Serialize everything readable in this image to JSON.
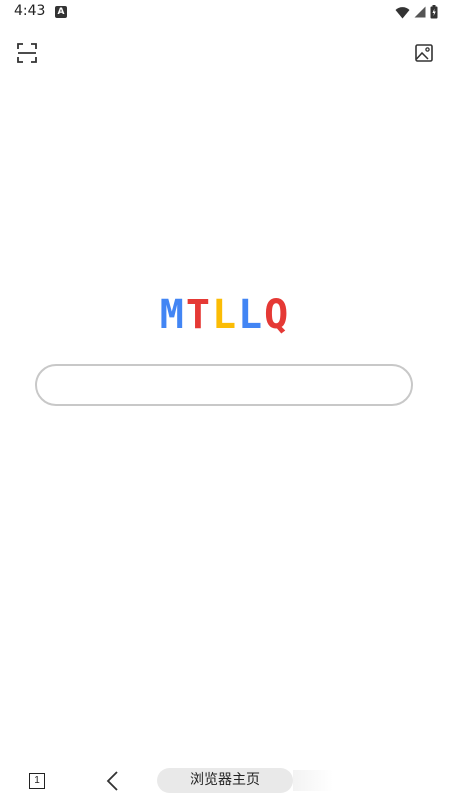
{
  "status_bar": {
    "time": "4:43",
    "notification_icon": "a-icon",
    "icons": [
      "wifi-icon",
      "signal-icon",
      "battery-icon"
    ]
  },
  "toolbar": {
    "left_icon": "scan-icon",
    "right_icon": "image-icon"
  },
  "logo": {
    "letters": [
      "M",
      "T",
      "L",
      "L",
      "Q"
    ],
    "colors": [
      "#4285f4",
      "#e53935",
      "#fbbc05",
      "#4285f4",
      "#e53935"
    ]
  },
  "search": {
    "value": "",
    "placeholder": ""
  },
  "bottom_bar": {
    "tab_count": "1",
    "back_icon": "chevron-left-icon",
    "home_label": "浏览器主页"
  }
}
